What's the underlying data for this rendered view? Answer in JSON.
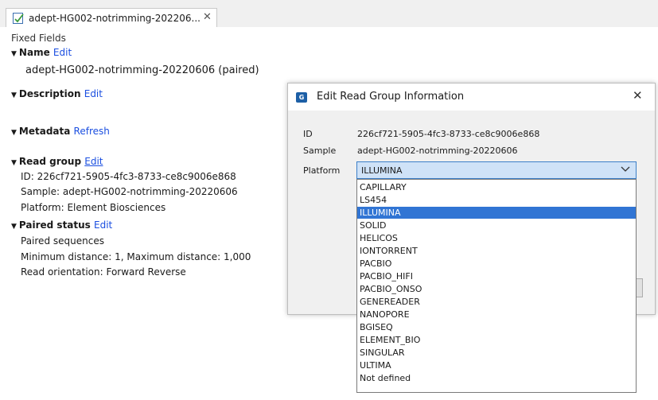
{
  "tab": {
    "title": "adept-HG002-notrimming-202206...",
    "close_glyph": "✕",
    "icon": "sequence-list-icon"
  },
  "panel": {
    "fixed_fields": "Fixed Fields",
    "name": {
      "label": "Name",
      "edit": "Edit",
      "value": "adept-HG002-notrimming-20220606 (paired)"
    },
    "description": {
      "label": "Description",
      "edit": "Edit"
    },
    "metadata": {
      "label": "Metadata",
      "refresh": "Refresh"
    },
    "read_group": {
      "label": "Read group",
      "edit": "Edit",
      "id_line": "ID: 226cf721-5905-4fc3-8733-ce8c9006e868",
      "sample_line": "Sample: adept-HG002-notrimming-20220606",
      "platform_line": "Platform: Element Biosciences"
    },
    "paired_status": {
      "label": "Paired status",
      "edit": "Edit",
      "line1": "Paired sequences",
      "line2": "Minimum distance: 1, Maximum distance: 1,000",
      "line3": "Read orientation: Forward Reverse"
    }
  },
  "dialog": {
    "title": "Edit Read Group Information",
    "icon_text": "G",
    "close_glyph": "✕",
    "id_label": "ID",
    "id_value": "226cf721-5905-4fc3-8733-ce8c9006e868",
    "sample_label": "Sample",
    "sample_value": "adept-HG002-notrimming-20220606",
    "platform_label": "Platform",
    "platform_selected": "ILLUMINA",
    "platform_options": [
      "CAPILLARY",
      "LS454",
      "ILLUMINA",
      "SOLID",
      "HELICOS",
      "IONTORRENT",
      "PACBIO",
      "PACBIO_HIFI",
      "PACBIO_ONSO",
      "GENEREADER",
      "NANOPORE",
      "BGISEQ",
      "ELEMENT_BIO",
      "SINGULAR",
      "ULTIMA",
      "Not defined"
    ],
    "selected_index": 2
  },
  "colors": {
    "link": "#1a4ee0",
    "selection": "#3175d4",
    "combo_bg": "#cfe2f7"
  }
}
